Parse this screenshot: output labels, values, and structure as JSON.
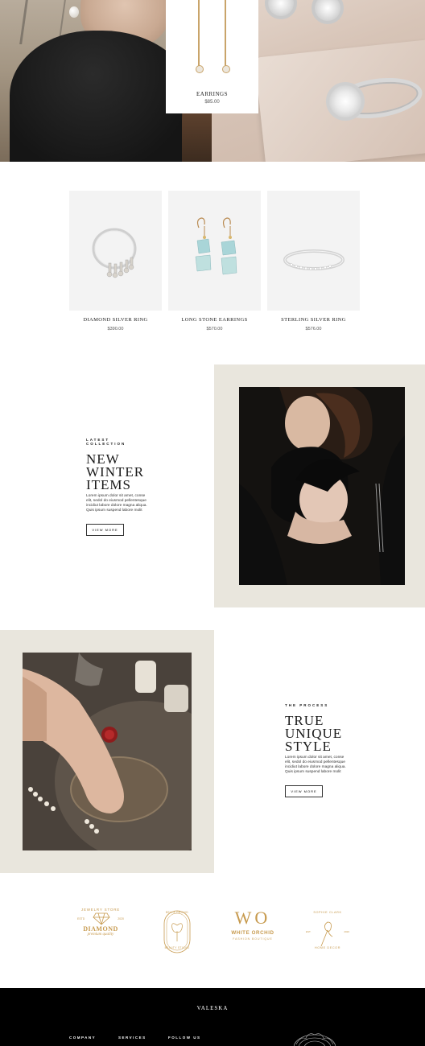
{
  "hero": {
    "card": {
      "name": "EARRINGS",
      "price": "$85.00"
    }
  },
  "products": [
    {
      "name": "DIAMOND SILVER RING",
      "price": "$390.00"
    },
    {
      "name": "LONG STONE EARRINGS",
      "price": "$570.00"
    },
    {
      "name": "STERLING SILVER RING",
      "price": "$576.00"
    }
  ],
  "collection": {
    "eyebrow": "LATEST COLLECTION",
    "title_lines": [
      "NEW",
      "WINTER",
      "ITEMS"
    ],
    "body": "Lorem ipsum dolor sit amet, conse elit, sedol do eiusmod pellentesque incidiut labore dolore magna aliqua. Quis ipsum suspend labore molit",
    "button": "VIEW MORE"
  },
  "process": {
    "eyebrow": "THE PROCESS",
    "title_lines": [
      "TRUE",
      "UNIQUE",
      "STYLE"
    ],
    "body": "Lorem ipsum dolor sit amet, conse elit, sedol do eiusmod pellentesque incidiut labore dolore magna aliqua. Quis ipsum suspend labore molit",
    "button": "VIEW MORE"
  },
  "logos": {
    "diamond": {
      "top": "JEWELRY STORE",
      "est": "ESTD",
      "year": "2020",
      "main": "DIAMOND",
      "script": "premium quality"
    },
    "bella": {
      "ring": "BELLA ORCHID",
      "bottom": "BEAUTY STUDIO"
    },
    "white_orchid": {
      "mono": "WO",
      "main": "WHITE ORCHID",
      "sub": "FASHION BOUTIQUE"
    },
    "sophie": {
      "top": "SOPHIE CLARK",
      "bottom": "HOME DECOR",
      "est": "EST.",
      "year": "2020"
    }
  },
  "footer": {
    "brand": "VALESKA",
    "columns": [
      "COMPANY",
      "SERVICES",
      "FOLLOW US"
    ]
  },
  "colors": {
    "beige": "#e9e6dd",
    "gold": "#c79a4e",
    "footer": "#000000"
  }
}
